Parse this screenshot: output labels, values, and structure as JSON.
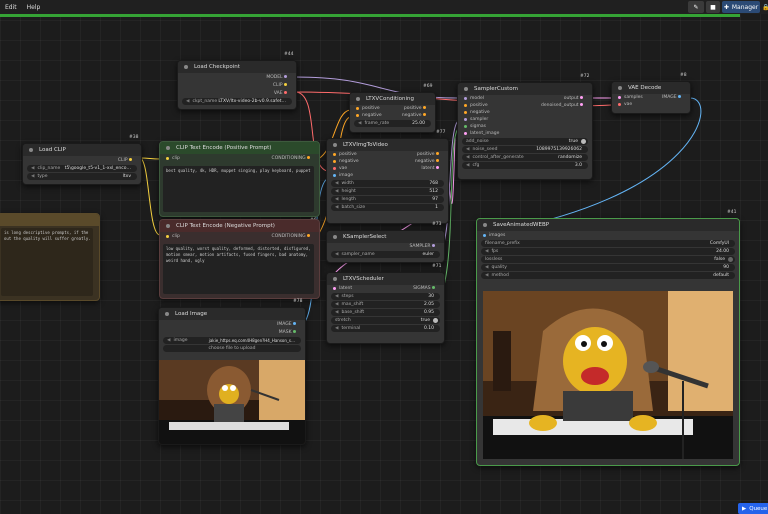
{
  "menu": {
    "edit": "Edit",
    "help": "Help"
  },
  "topbar": {
    "manager": "Manager"
  },
  "queue": {
    "label": "Queue"
  },
  "nodes": {
    "load_checkpoint": {
      "title": "Load Checkpoint",
      "id": "#44",
      "outputs": [
        "MODEL",
        "CLIP",
        "VAE"
      ],
      "ckpt_label": "ckpt_name",
      "ckpt_value": "LTXV/ltx-video-2b-v0.9.safet…"
    },
    "load_clip": {
      "title": "Load CLIP",
      "id": "#38",
      "output": "CLIP",
      "clip_label": "clip_name",
      "clip_value": "t5\\google_t5-v1_1-xxl_enco…",
      "type_label": "type",
      "type_value": "ltxv"
    },
    "clip_pos": {
      "title": "CLIP Text Encode (Positive Prompt)",
      "id": "#6",
      "input": "clip",
      "output": "CONDITIONING",
      "text": "best quality, 4k, HDR, muppet singing, play keyboard, puppet"
    },
    "clip_neg": {
      "title": "CLIP Text Encode (Negative Prompt)",
      "input": "clip",
      "output": "CONDITIONING",
      "text": "low quality, worst quality, deformed, distorted, disfigured, motion smear, motion artifacts, fused fingers, bad anatomy, weird hand, ugly"
    },
    "ltxv_cond": {
      "title": "LTXVConditioning",
      "id": "#69",
      "inputs": [
        "positive",
        "negative"
      ],
      "outputs": [
        "positive",
        "negative"
      ],
      "frame_rate_label": "frame_rate",
      "frame_rate_value": "25.00"
    },
    "ltxv_img2vid": {
      "title": "LTXVImgToVideo",
      "id": "#77",
      "inputs": [
        "positive",
        "negative",
        "vae",
        "image"
      ],
      "outputs": [
        "positive",
        "negative",
        "latent"
      ],
      "width_label": "width",
      "width_value": "768",
      "height_label": "height",
      "height_value": "512",
      "length_label": "length",
      "length_value": "97",
      "batch_label": "batch_size",
      "batch_value": "1"
    },
    "sampler_custom": {
      "title": "SamplerCustom",
      "id": "#72",
      "inputs": [
        "model",
        "positive",
        "negative",
        "sampler",
        "sigmas",
        "latent_image"
      ],
      "outputs": [
        "output",
        "denoised_output"
      ],
      "add_noise_label": "add_noise",
      "add_noise_value": "true",
      "noise_seed_label": "noise_seed",
      "noise_seed_value": "1089975139926062",
      "control_label": "control_after_generate",
      "control_value": "randomize",
      "cfg_label": "cfg",
      "cfg_value": "3.0"
    },
    "vae_decode": {
      "title": "VAE Decode",
      "id": "#8",
      "inputs": [
        "samples",
        "vae"
      ],
      "output": "IMAGE"
    },
    "ksampler_select": {
      "title": "KSamplerSelect",
      "id": "#73",
      "output": "SAMPLER",
      "sampler_label": "sampler_name",
      "sampler_value": "euler"
    },
    "ltxv_scheduler": {
      "title": "LTXVScheduler",
      "id": "#71",
      "input": "latent",
      "output": "SIGMAS",
      "steps_label": "steps",
      "steps_value": "30",
      "max_shift_label": "max_shift",
      "max_shift_value": "2.05",
      "base_shift_label": "base_shift",
      "base_shift_value": "0.95",
      "stretch_label": "stretch",
      "stretch_value": "true",
      "terminal_label": "terminal",
      "terminal_value": "0.10"
    },
    "load_image": {
      "title": "Load Image",
      "id": "#78",
      "outputs": [
        "IMAGE",
        "MASK"
      ],
      "image_label": "image",
      "image_value": "jakie_https.eq.com4H8gen?H4_Hanson_s…",
      "upload_label": "choose file to upload"
    },
    "save_webp": {
      "title": "SaveAnimatedWEBP",
      "id": "#41",
      "input": "images",
      "filename_label": "filename_prefix",
      "filename_value": "ComfyUI",
      "fps_label": "fps",
      "fps_value": "24.00",
      "lossless_label": "lossless",
      "lossless_value": "false",
      "quality_label": "quality",
      "quality_value": "90",
      "method_label": "method",
      "method_value": "default"
    },
    "note": {
      "text": "is long descriptive prompts, if the\nout the quality will suffer greatly."
    }
  },
  "colors": {
    "clip_wire": "#f4d03f",
    "model_wire": "#b39ddb",
    "vae_wire": "#ff6b6b",
    "cond_wire": "#ffa726",
    "image_wire": "#64b5f6",
    "latent_wire": "#ff9ff3",
    "accent": "#2563eb"
  }
}
